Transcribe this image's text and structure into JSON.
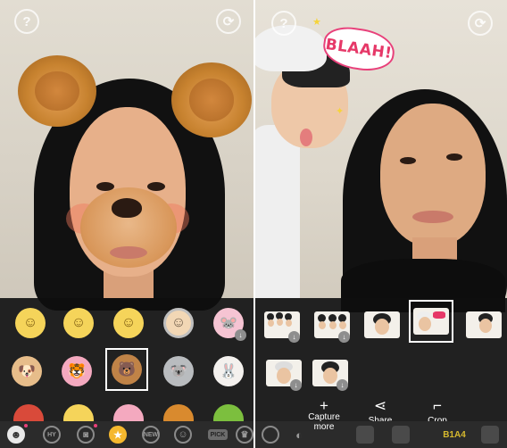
{
  "left_screen": {
    "top_buttons": {
      "help_glyph": "?",
      "flip_glyph": "⟳"
    },
    "sticker_grid": [
      {
        "name": "camera-swap-face",
        "glyph": "☺"
      },
      {
        "name": "face-swap-left",
        "glyph": "☺"
      },
      {
        "name": "face-swap-right",
        "glyph": "☺"
      },
      {
        "name": "grandma-face",
        "glyph": "☺"
      },
      {
        "name": "pink-mouse",
        "glyph": "🐭"
      },
      {
        "name": "puppy-heart",
        "glyph": "🐶"
      },
      {
        "name": "pink-lion",
        "glyph": "🐯"
      },
      {
        "name": "brown-bear",
        "glyph": "🐻"
      },
      {
        "name": "koala",
        "glyph": "🐨"
      },
      {
        "name": "white-rabbit",
        "glyph": "🐰"
      }
    ],
    "bottom_tabs": [
      {
        "name": "face-tab",
        "label": ""
      },
      {
        "name": "hy-tab",
        "label": "HY"
      },
      {
        "name": "camera-tab",
        "label": ""
      },
      {
        "name": "hot-tab",
        "label": "HOT"
      },
      {
        "name": "new-tab",
        "label": "NEW"
      },
      {
        "name": "emoji-tab",
        "label": ""
      },
      {
        "name": "pick-tab",
        "label": "PICK"
      },
      {
        "name": "more-tab",
        "label": ""
      }
    ]
  },
  "right_screen": {
    "top_buttons": {
      "help_glyph": "?",
      "flip_glyph": "⟳"
    },
    "sticker_text": "BLAAH!",
    "actions": [
      {
        "name": "capture-more",
        "icon": "+",
        "label": "Capture more"
      },
      {
        "name": "share",
        "icon": "⋖",
        "label": "Share"
      },
      {
        "name": "crop",
        "icon": "⌐",
        "label": "Crop"
      }
    ],
    "bottom_brand": "B1A4"
  },
  "colors": {
    "panel_bg": "#0e0e0e",
    "bar_bg": "#2b2b2b",
    "hot_accent": "#f5b82e",
    "badge_dot": "#e8407a",
    "sticker_text_color": "#e63868"
  }
}
